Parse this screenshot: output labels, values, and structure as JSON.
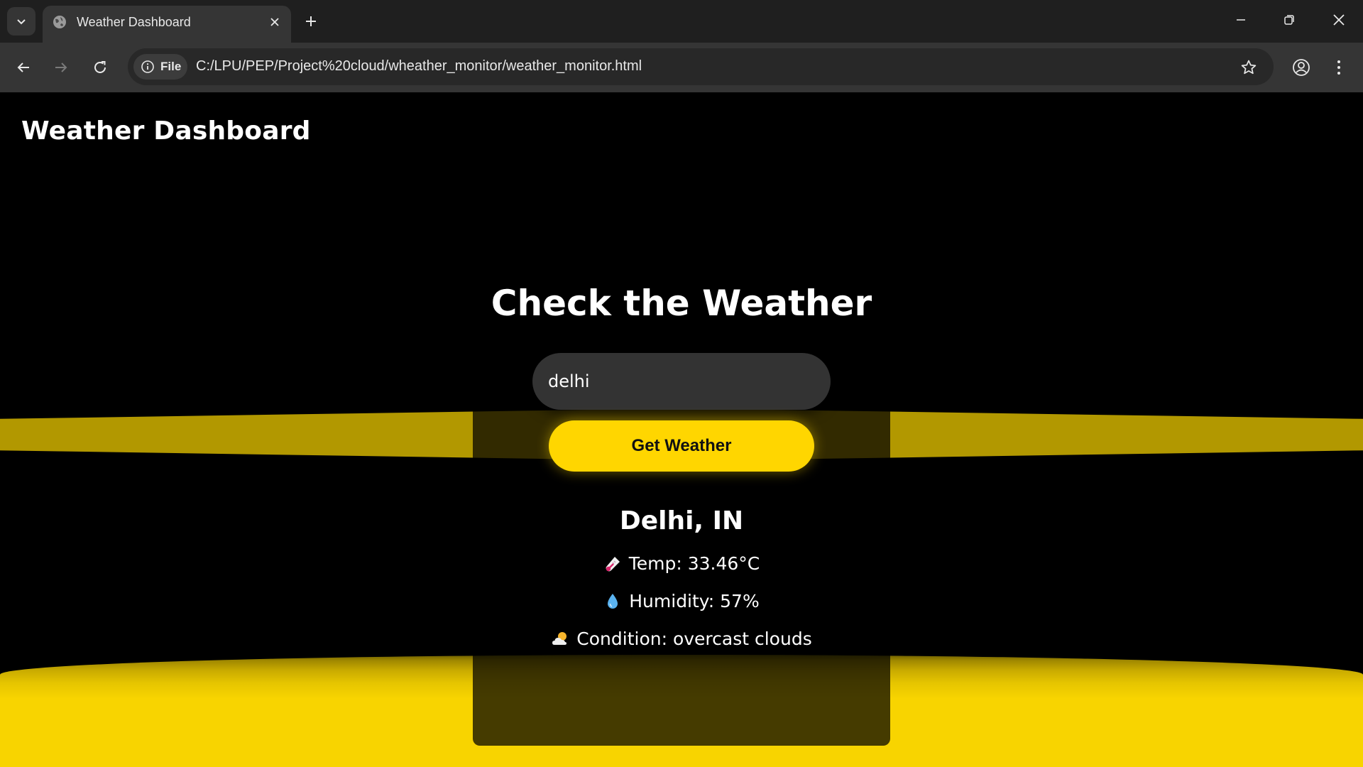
{
  "browser": {
    "tab": {
      "title": "Weather Dashboard"
    },
    "address_bar": {
      "site_chip_label": "File",
      "url": "C:/LPU/PEP/Project%20cloud/wheather_monitor/weather_monitor.html"
    }
  },
  "page": {
    "site_title": "Weather Dashboard",
    "heading": "Check the Weather",
    "search": {
      "value": "delhi"
    },
    "button_label": "Get Weather",
    "result": {
      "location": "Delhi, IN",
      "temperature": "Temp: 33.46°C",
      "humidity": "Humidity: 57%",
      "condition": "Condition: overcast clouds"
    }
  },
  "colors": {
    "accent": "#ffd600",
    "band": "#b29800",
    "background": "#000000",
    "input_bg": "#333333"
  },
  "icons": {
    "temperature": "thermometer-icon",
    "humidity": "droplet-icon",
    "condition": "cloud-sun-icon"
  }
}
